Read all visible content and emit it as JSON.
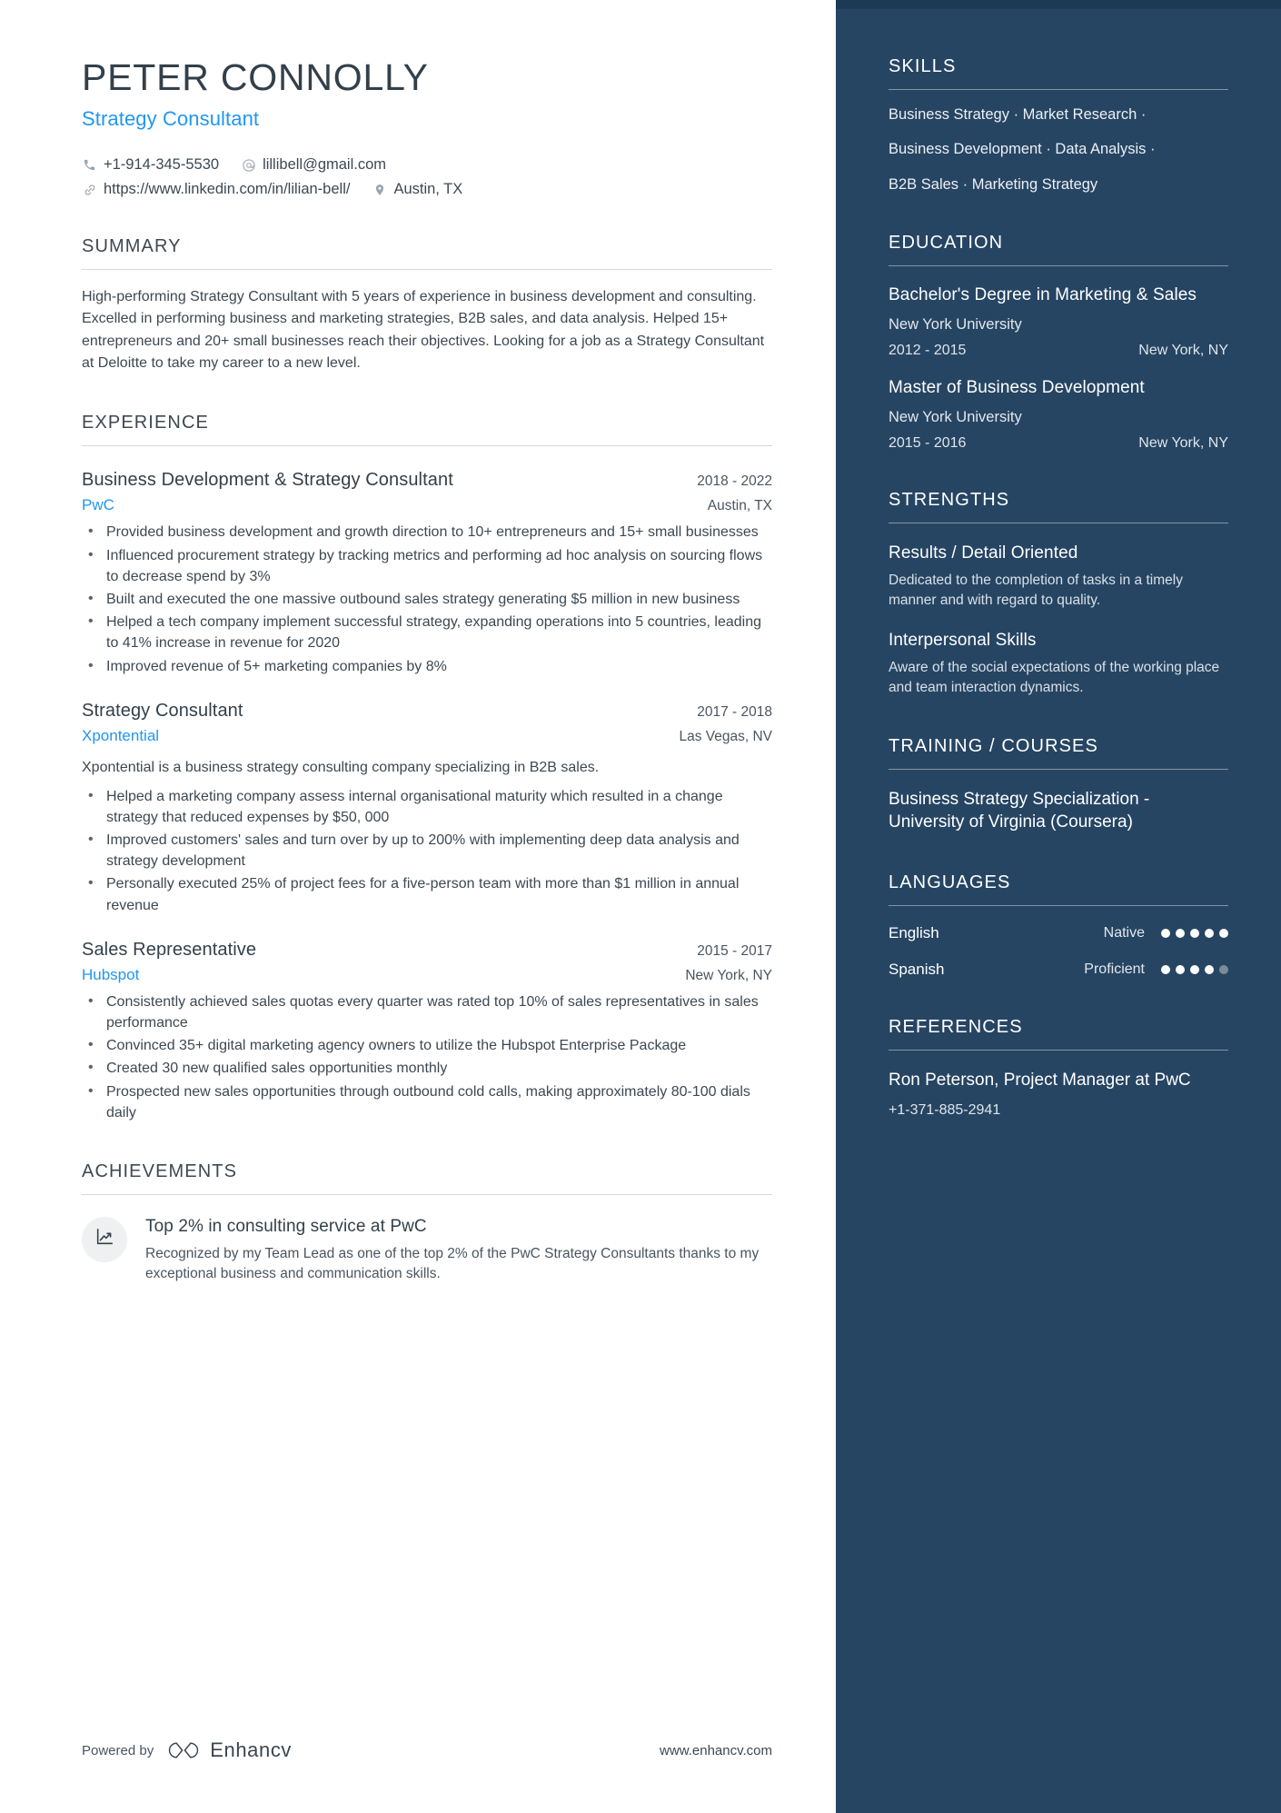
{
  "header": {
    "name": "PETER CONNOLLY",
    "title": "Strategy Consultant",
    "contacts": [
      {
        "icon": "phone-icon",
        "text": "+1-914-345-5530"
      },
      {
        "icon": "email-icon",
        "text": "lillibell@gmail.com"
      },
      {
        "icon": "link-icon",
        "text": "https://www.linkedin.com/in/lilian-bell/"
      },
      {
        "icon": "location-pin-icon",
        "text": "Austin, TX"
      }
    ]
  },
  "summary": {
    "heading": "SUMMARY",
    "text": "High-performing Strategy Consultant with 5 years of experience in business development and consulting. Excelled in performing business and marketing strategies, B2B sales, and data analysis. Helped 15+ entrepreneurs and 20+ small businesses reach their objectives. Looking for a job as a Strategy Consultant at Deloitte to take my career to a new level."
  },
  "experience": {
    "heading": "EXPERIENCE",
    "jobs": [
      {
        "role": "Business Development & Strategy Consultant",
        "dates": "2018 - 2022",
        "company": "PwC",
        "location": "Austin, TX",
        "description": "",
        "bullets": [
          "Provided business development and growth direction to 10+ entrepreneurs and 15+ small businesses",
          "Influenced procurement strategy by tracking metrics and performing ad hoc analysis on sourcing flows to decrease spend by 3%",
          "Built and executed the one massive outbound sales strategy generating $5 million in new business",
          "Helped a tech company implement successful strategy, expanding operations into 5 countries, leading to 41% increase in revenue for 2020",
          "Improved revenue of 5+ marketing companies by 8%"
        ]
      },
      {
        "role": "Strategy Consultant",
        "dates": "2017 - 2018",
        "company": "Xpontential",
        "location": "Las Vegas, NV",
        "description": "Xpontential is a business strategy consulting company specializing in B2B sales.",
        "bullets": [
          "Helped a marketing company assess internal organisational maturity which resulted in a change strategy that reduced expenses by $50, 000",
          "Improved customers' sales and turn over by up to 200% with implementing deep data analysis and strategy development",
          "Personally executed 25% of project fees for a five-person team with more than $1 million in annual revenue"
        ]
      },
      {
        "role": "Sales Representative",
        "dates": "2015 - 2017",
        "company": "Hubspot",
        "location": "New York, NY",
        "description": "",
        "bullets": [
          "Consistently achieved sales quotas every quarter was rated top 10% of sales representatives in sales performance",
          "Convinced 35+ digital marketing agency owners to utilize the Hubspot Enterprise Package",
          "Created 30 new qualified sales opportunities monthly",
          "Prospected new sales opportunities through outbound cold calls, making approximately 80-100 dials daily"
        ]
      }
    ]
  },
  "achievements": {
    "heading": "ACHIEVEMENTS",
    "items": [
      {
        "icon": "growth-chart-icon",
        "title": "Top 2% in consulting service at PwC",
        "text": "Recognized by my Team Lead as one of the top 2% of the PwC Strategy Consultants thanks to my exceptional business and communication skills."
      }
    ]
  },
  "footer": {
    "powered_by": "Powered by",
    "brand": "Enhancv",
    "url": "www.enhancv.com"
  },
  "sidebar": {
    "skills": {
      "heading": "SKILLS",
      "lines": [
        "Business Strategy · Market Research ·",
        "Business Development · Data Analysis ·",
        "B2B Sales · Marketing Strategy"
      ]
    },
    "education": {
      "heading": "EDUCATION",
      "entries": [
        {
          "degree": "Bachelor's Degree in Marketing & Sales",
          "school": "New York University",
          "dates": "2012 - 2015",
          "location": "New York, NY"
        },
        {
          "degree": "Master of Business Development",
          "school": "New York University",
          "dates": "2015 - 2016",
          "location": "New York, NY"
        }
      ]
    },
    "strengths": {
      "heading": "STRENGTHS",
      "entries": [
        {
          "title": "Results / Detail Oriented",
          "text": "Dedicated to the completion of tasks in a timely manner and with regard to quality."
        },
        {
          "title": "Interpersonal Skills",
          "text": "Aware of the social expectations of the working place and team interaction dynamics."
        }
      ]
    },
    "training": {
      "heading": "TRAINING / COURSES",
      "items": [
        "Business Strategy Specialization - University of Virginia (Coursera)"
      ]
    },
    "languages": {
      "heading": "LANGUAGES",
      "entries": [
        {
          "name": "English",
          "level": "Native",
          "filled": 5,
          "total": 5
        },
        {
          "name": "Spanish",
          "level": "Proficient",
          "filled": 4,
          "total": 5
        }
      ]
    },
    "references": {
      "heading": "REFERENCES",
      "entries": [
        {
          "name": "Ron Peterson, Project Manager at PwC",
          "phone": "+1-371-885-2941"
        }
      ]
    }
  },
  "colors": {
    "accent_blue": "#2196f3",
    "sidebar_bg": "#264563",
    "heading_text": "#3d4852"
  }
}
